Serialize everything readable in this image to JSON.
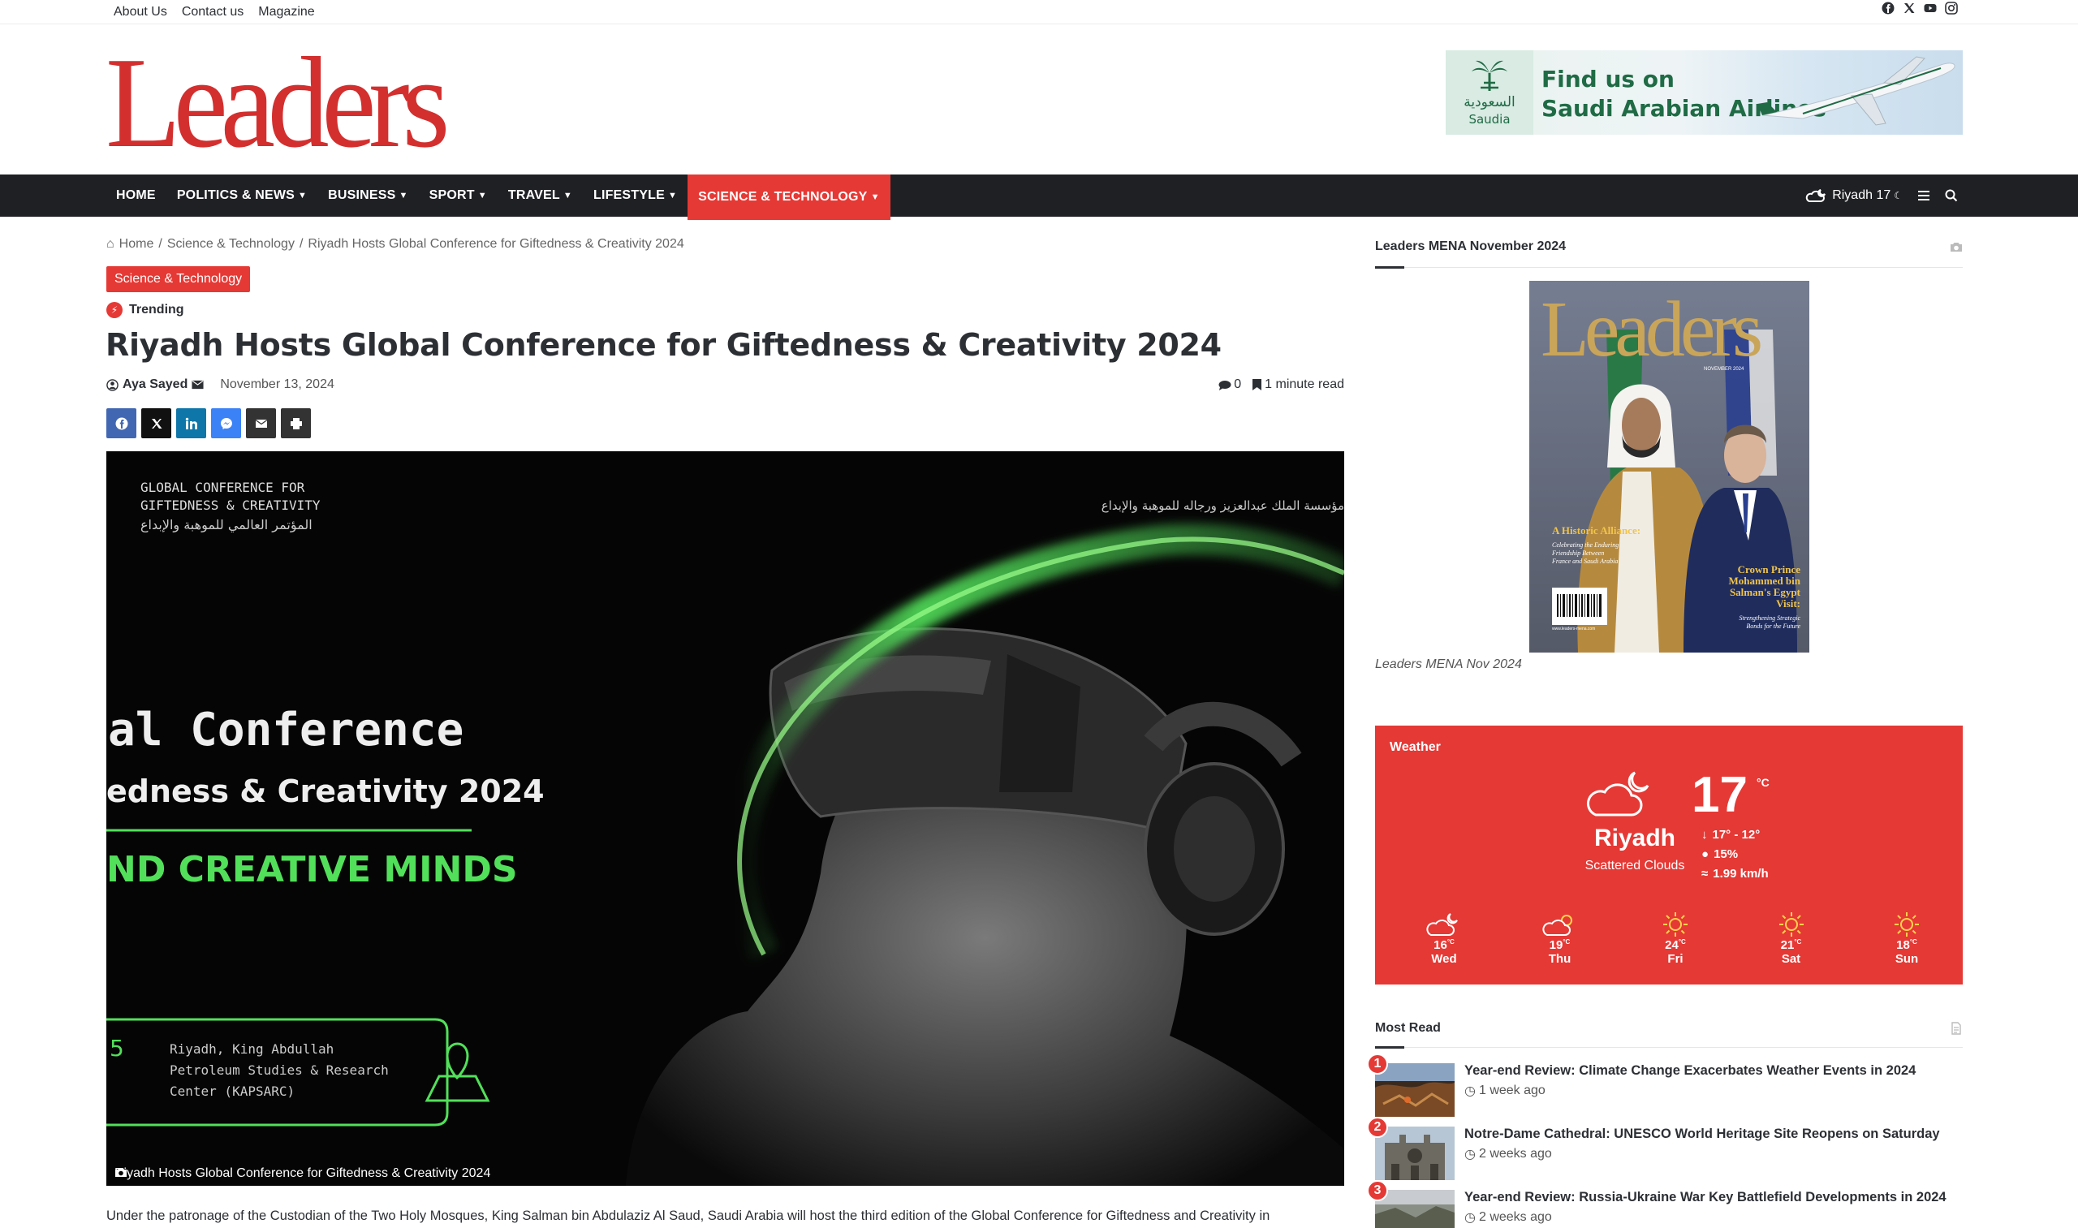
{
  "topbar": {
    "links": [
      "About Us",
      "Contact us",
      "Magazine"
    ],
    "social_icons": [
      "facebook-icon",
      "x-icon",
      "youtube-icon",
      "instagram-icon"
    ]
  },
  "header": {
    "logo_text": "Leaders",
    "ad": {
      "line1": "Find us on",
      "line2": "Saudi Arabian Airlines",
      "brand_ar": "السعودية",
      "brand": "Saudia"
    }
  },
  "nav": {
    "items": [
      {
        "label": "HOME",
        "dropdown": false
      },
      {
        "label": "POLITICS & NEWS",
        "dropdown": true
      },
      {
        "label": "BUSINESS",
        "dropdown": true
      },
      {
        "label": "SPORT",
        "dropdown": true
      },
      {
        "label": "TRAVEL",
        "dropdown": true
      },
      {
        "label": "LIFESTYLE",
        "dropdown": true
      },
      {
        "label": "SCIENCE & TECHNOLOGY",
        "dropdown": true,
        "active": true
      }
    ],
    "weather_label": "Riyadh  17"
  },
  "article": {
    "breadcrumb": [
      "Home",
      "Science & Technology",
      "Riyadh Hosts Global Conference for Giftedness & Creativity 2024"
    ],
    "category": "Science & Technology",
    "trending": "Trending",
    "title": "Riyadh Hosts Global Conference for Giftedness & Creativity 2024",
    "author": "Aya Sayed",
    "date": "November 13, 2024",
    "comments": "0",
    "read_time": "1 minute read",
    "hero": {
      "top_left_1": "GLOBAL CONFERENCE FOR",
      "top_left_2": "GIFTEDNESS & CREATIVITY",
      "top_left_ar": "المؤتمر العالمي للموهبة والإبداع",
      "top_right_ar": "مؤسسة الملك عبدالعزيز ورجاله للموهبة والإبداع",
      "big_1": "al Conference",
      "big_2": "edness & Creativity 2024",
      "big_3": "ND CREATIVE MINDS",
      "venue_1": "Riyadh, King Abdullah",
      "venue_2": "Petroleum Studies & Research",
      "venue_3": "Center (KAPSARC)",
      "venue_left": "5"
    },
    "caption": "Riyadh Hosts Global Conference for Giftedness & Creativity 2024",
    "body": "Under the patronage of the Custodian of the Two Holy Mosques, King Salman bin Abdulaziz Al Saud, Saudi Arabia will host the third edition of the Global Conference for Giftedness and Creativity in"
  },
  "sidebar": {
    "magazine": {
      "title": "Leaders MENA November 2024",
      "caption": "Leaders MENA Nov 2024",
      "cover_logo": "Leaders",
      "cover_issue": "NOVEMBER 2024",
      "cover_left_h": "A Historic Alliance:",
      "cover_left_s1": "Celebrating the Enduring",
      "cover_left_s2": "Friendship Between",
      "cover_left_s3": "France and Saudi Arabia",
      "cover_right_h1": "Crown Prince",
      "cover_right_h2": "Mohammed bin",
      "cover_right_h3": "Salman's Egypt",
      "cover_right_h4": "Visit:",
      "cover_right_s1": "Strengthening Strategic",
      "cover_right_s2": "Bonds for the Future",
      "cover_url": "www.leaders-mena.com"
    },
    "weather": {
      "title": "Weather",
      "city": "Riyadh",
      "description": "Scattered Clouds",
      "temp": "17",
      "unit": "°C",
      "range": "17° - 12°",
      "humidity": "15%",
      "wind": "1.99 km/h",
      "forecast": [
        {
          "day": "Wed",
          "temp": "16",
          "icon": "night-cloud-icon"
        },
        {
          "day": "Thu",
          "temp": "19",
          "icon": "sun-cloud-icon"
        },
        {
          "day": "Fri",
          "temp": "24",
          "icon": "sun-icon"
        },
        {
          "day": "Sat",
          "temp": "21",
          "icon": "sun-icon"
        },
        {
          "day": "Sun",
          "temp": "18",
          "icon": "sun-icon"
        }
      ],
      "deg": "°C"
    },
    "most_read": {
      "title": "Most Read",
      "items": [
        {
          "num": "1",
          "title": "Year-end Review: Climate Change Exacerbates Weather Events in 2024",
          "ago": "1 week ago"
        },
        {
          "num": "2",
          "title": "Notre-Dame Cathedral: UNESCO World Heritage Site Reopens on Saturday",
          "ago": "2 weeks ago"
        },
        {
          "num": "3",
          "title": "Year-end Review: Russia-Ukraine War Key Battlefield Developments in 2024",
          "ago": "2 weeks ago"
        }
      ]
    }
  },
  "colors": {
    "accent": "#e53935",
    "nav_bg": "#1f2024",
    "text": "#2c2f34",
    "neon_green": "#52e05a"
  }
}
